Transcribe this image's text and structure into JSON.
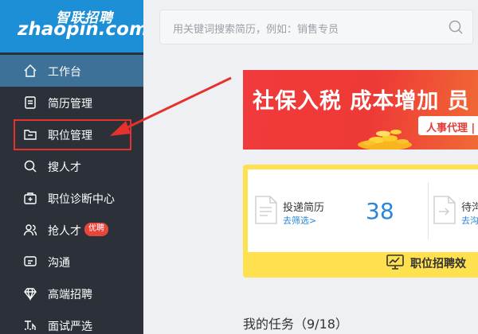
{
  "logo": {
    "cn": "智联招聘",
    "en": "zhaopin.com"
  },
  "sidebar": {
    "items": [
      {
        "label": "工作台",
        "icon": "home-icon",
        "active": true
      },
      {
        "label": "简历管理",
        "icon": "document-icon"
      },
      {
        "label": "职位管理",
        "icon": "folder-icon",
        "highlighted": true
      },
      {
        "label": "搜人才",
        "icon": "search-icon"
      },
      {
        "label": "职位诊断中心",
        "icon": "medical-kit-icon"
      },
      {
        "label": "抢人才",
        "icon": "users-icon",
        "badge": "优聘"
      },
      {
        "label": "沟通",
        "icon": "chat-icon"
      },
      {
        "label": "高端招聘",
        "icon": "diamond-icon"
      },
      {
        "label": "面试严选",
        "icon": "interview-icon"
      }
    ]
  },
  "search": {
    "placeholder": "用关键词搜索简历，例如：销售专员"
  },
  "banner": {
    "title": "社保入税 成本增加 员",
    "tag": "人事代理 |"
  },
  "stats": {
    "delivered": {
      "label": "投递简历",
      "link": "去筛选>",
      "value": "38"
    },
    "pending": {
      "label": "待沟",
      "link": "去沟"
    },
    "footer": "职位招聘效"
  },
  "tasks": {
    "title": "我的任务（9/18）"
  },
  "colors": {
    "sidebar": "#2b3039",
    "logo_bg": "#1d8fd6",
    "active_item": "#3e7197",
    "highlight": "#e5322d",
    "accent_blue": "#2a86d6",
    "banner_red": "#ee3a36",
    "card_yellow": "#ffe14f"
  }
}
